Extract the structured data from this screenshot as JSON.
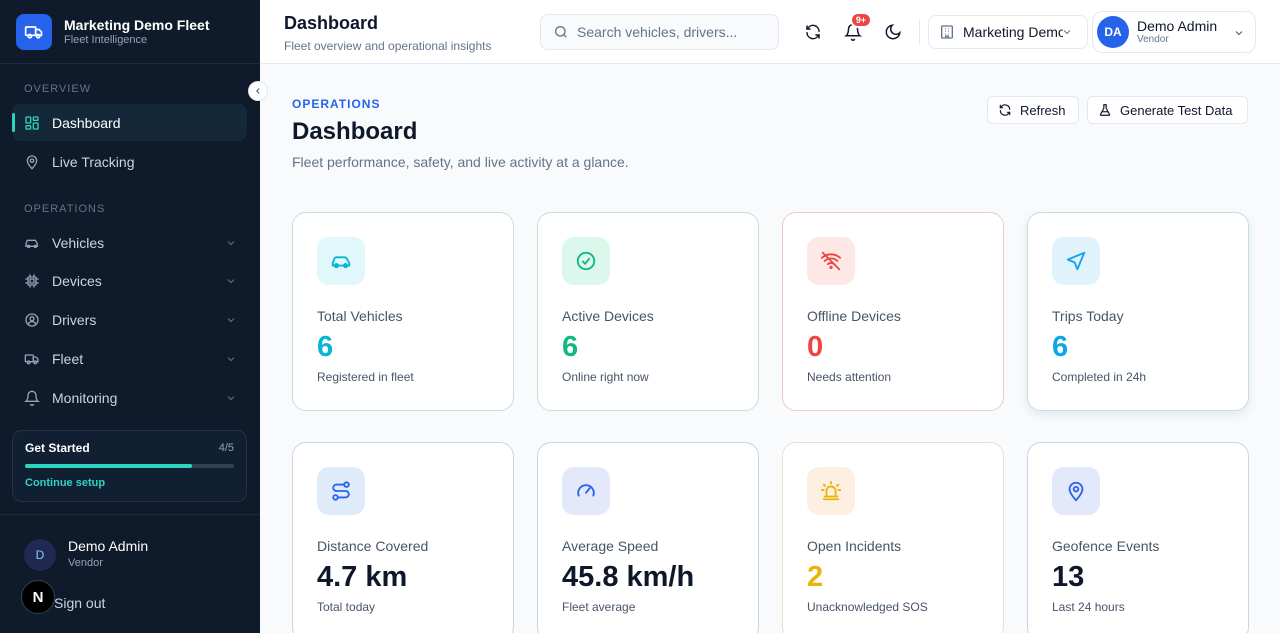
{
  "brand": {
    "title": "Marketing Demo Fleet",
    "subtitle": "Fleet Intelligence"
  },
  "sidebar": {
    "sections": [
      {
        "label": "OVERVIEW"
      },
      {
        "label": "OPERATIONS"
      }
    ],
    "items": [
      {
        "label": "Dashboard",
        "icon": "grid-icon",
        "active": true
      },
      {
        "label": "Live Tracking",
        "icon": "map-pin-icon"
      },
      {
        "label": "Vehicles",
        "icon": "car-icon"
      },
      {
        "label": "Devices",
        "icon": "chip-icon"
      },
      {
        "label": "Drivers",
        "icon": "user-circle-icon"
      },
      {
        "label": "Fleet",
        "icon": "truck-icon"
      },
      {
        "label": "Monitoring",
        "icon": "bell-icon"
      }
    ],
    "get_started": {
      "title": "Get Started",
      "count": "4/5",
      "progress": 0.8,
      "link": "Continue setup"
    },
    "user": {
      "initials": "D",
      "name": "Demo Admin",
      "role": "Vendor",
      "signout": "Sign out"
    },
    "n_badge": "N"
  },
  "header": {
    "title": "Dashboard",
    "subtitle": "Fleet overview and operational insights",
    "search_placeholder": "Search vehicles, drivers...",
    "notif_badge": "9+",
    "org": "Marketing Demo Fleet",
    "user": {
      "initials": "DA",
      "name": "Demo Admin",
      "role": "Vendor"
    }
  },
  "page": {
    "eyebrow": "OPERATIONS",
    "title": "Dashboard",
    "subtitle": "Fleet performance, safety, and live activity at a glance.",
    "refresh_label": "Refresh",
    "generate_label": "Generate Test Data"
  },
  "cards": [
    {
      "label": "Total Vehicles",
      "value": "6",
      "caption": "Registered in fleet",
      "icon": "car-icon",
      "color": "#06b6d4",
      "bg": "#e0f7fb",
      "border": "#c7dde6"
    },
    {
      "label": "Active Devices",
      "value": "6",
      "caption": "Online right now",
      "icon": "check-circle-icon",
      "color": "#10b981",
      "bg": "#dcf7ec",
      "border": "#c7dde0"
    },
    {
      "label": "Offline Devices",
      "value": "0",
      "caption": "Needs attention",
      "icon": "wifi-off-icon",
      "color": "#ef4444",
      "bg": "#fde8e5",
      "border": "#f0c7cc"
    },
    {
      "label": "Trips Today",
      "value": "6",
      "caption": "Completed in 24h",
      "icon": "navigation-icon",
      "color": "#0ea5e9",
      "bg": "#e0f3fb",
      "border": "#c7dde6"
    },
    {
      "label": "Distance Covered",
      "value": "4.7 km",
      "caption": "Total today",
      "icon": "route-icon",
      "color": "#0f172a",
      "bg": "#e0ebfa",
      "border": "#c7d5e6"
    },
    {
      "label": "Average Speed",
      "value": "45.8 km/h",
      "caption": "Fleet average",
      "icon": "gauge-icon",
      "color": "#0f172a",
      "bg": "#e3e8fb",
      "border": "#c7d5e6"
    },
    {
      "label": "Open Incidents",
      "value": "2",
      "caption": "Unacknowledged SOS",
      "icon": "siren-icon",
      "color": "#eab308",
      "bg": "#fdf0e2",
      "border": "#eadfcf"
    },
    {
      "label": "Geofence Events",
      "value": "13",
      "caption": "Last 24 hours",
      "icon": "location-pin-icon",
      "color": "#0f172a",
      "bg": "#e3e8fb",
      "border": "#c7d5e6"
    }
  ]
}
